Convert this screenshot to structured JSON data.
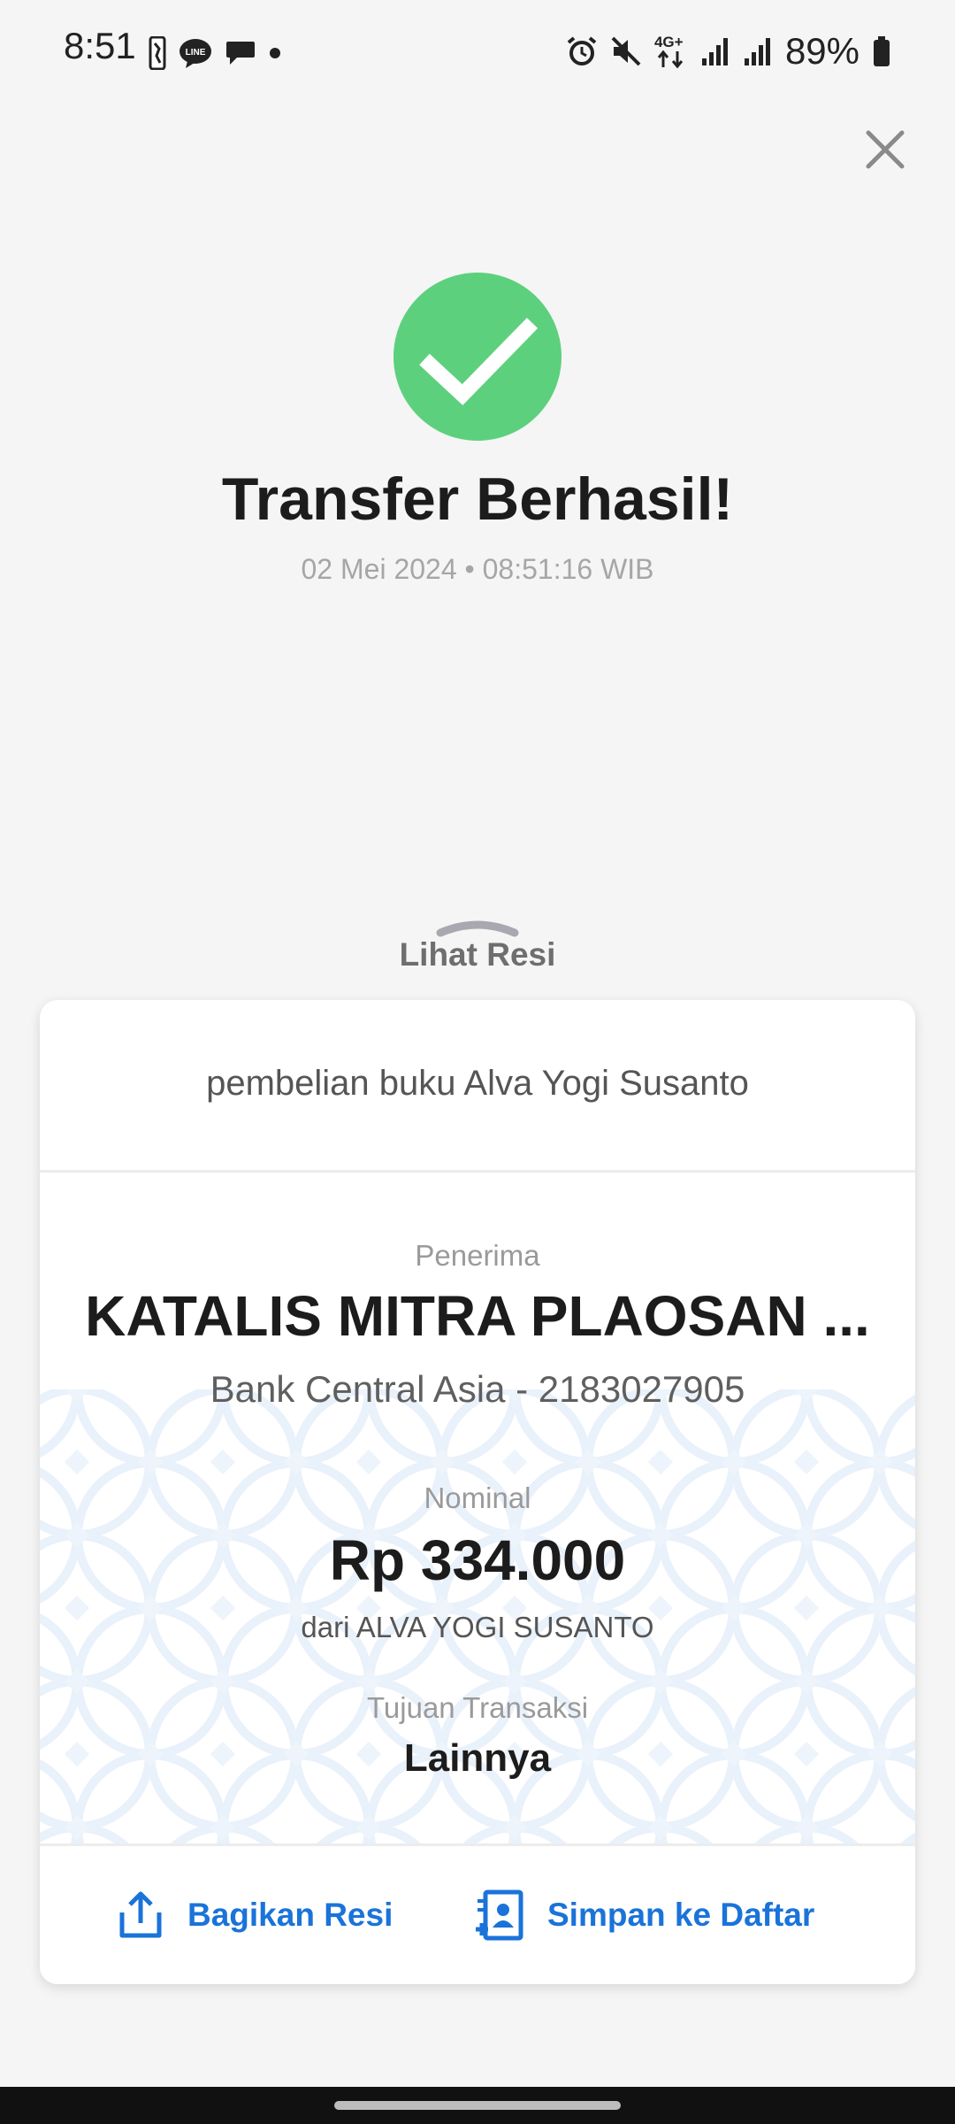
{
  "status_bar": {
    "time": "8:51",
    "battery": "89%",
    "network": "4G+",
    "left_icons": [
      "nba-icon",
      "line-icon",
      "chat-bubble-icon",
      "notification-dot-icon"
    ],
    "right_icons": [
      "alarm-icon",
      "mute-icon",
      "network-4g-icon",
      "signal-icon",
      "signal-icon",
      "battery-icon"
    ]
  },
  "header": {
    "close_icon": "close-icon",
    "success_icon": "checkmark-icon",
    "success_color": "#5dd07e",
    "title": "Transfer Berhasil!",
    "datetime": "02 Mei 2024 • 08:51:16 WIB"
  },
  "receipt_toggle": {
    "label": "Lihat Resi",
    "icon": "chevron-up-icon"
  },
  "receipt": {
    "note": "pembelian buku Alva Yogi Susanto",
    "recipient_label": "Penerima",
    "recipient_name": "KATALIS MITRA PLAOSAN ...",
    "recipient_bank": "Bank Central Asia - 2183027905",
    "amount_label": "Nominal",
    "amount": "Rp 334.000",
    "sender": "dari ALVA YOGI SUSANTO",
    "purpose_label": "Tujuan Transaksi",
    "purpose": "Lainnya"
  },
  "actions": {
    "share_label": "Bagikan Resi",
    "share_icon": "share-icon",
    "save_label": "Simpan ke Daftar",
    "save_icon": "add-contact-icon",
    "accent": "#1a73d9"
  }
}
